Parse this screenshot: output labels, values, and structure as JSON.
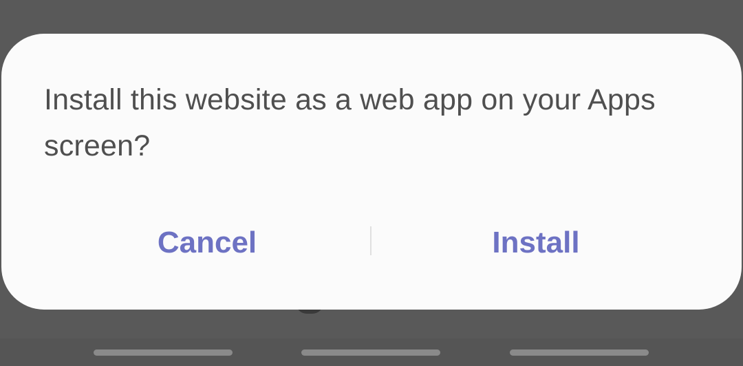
{
  "dialog": {
    "message": "Install this website as a web app on your Apps screen?",
    "cancel_label": "Cancel",
    "install_label": "Install"
  },
  "colors": {
    "scrim": "#595959",
    "dialog_background": "#fbfbfb",
    "message_text": "#4f4f4f",
    "button_text": "#6d72c3"
  }
}
